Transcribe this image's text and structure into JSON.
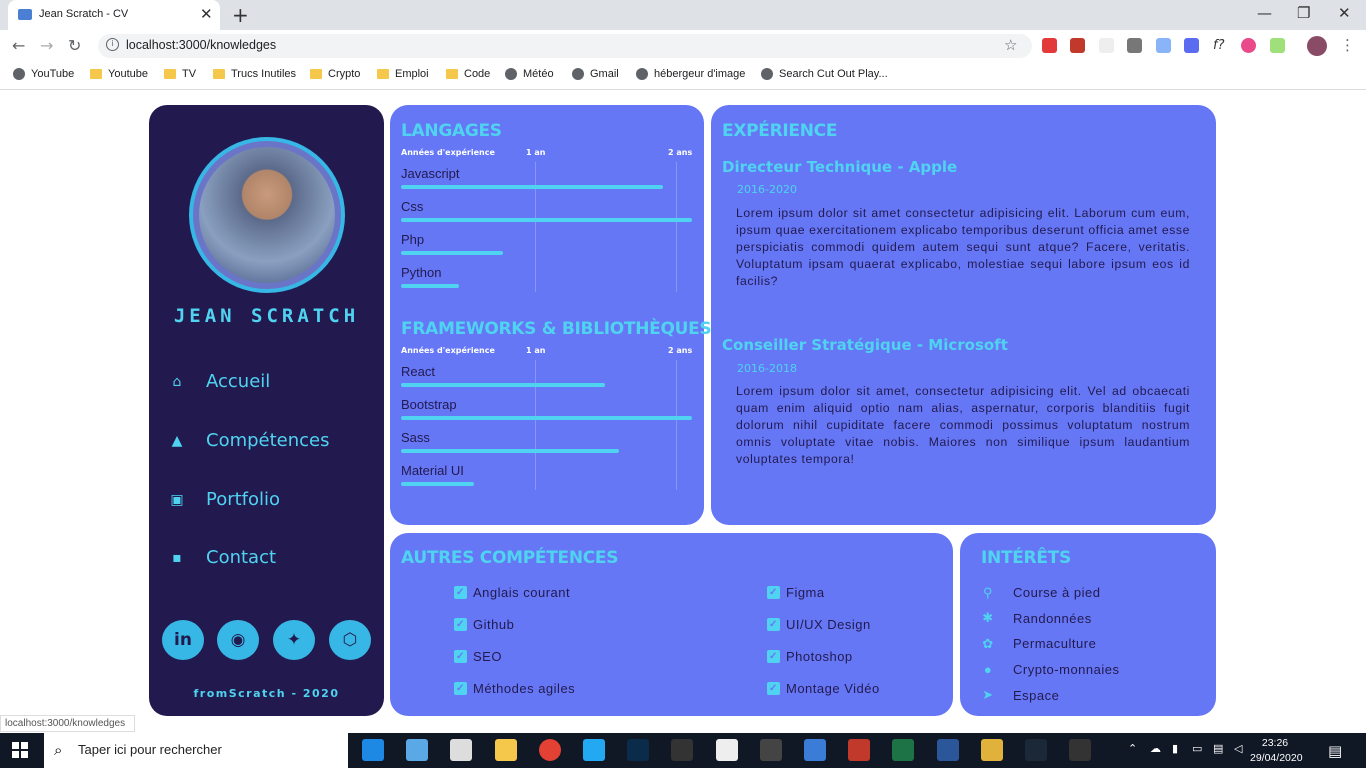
{
  "browser": {
    "tab_title": "Jean Scratch - CV",
    "url": "localhost:3000/knowledges",
    "status_url": "localhost:3000/knowledges",
    "bookmarks": [
      {
        "label": "YouTube",
        "icon": "globe-icon"
      },
      {
        "label": "Youtube",
        "icon": "folder-icon"
      },
      {
        "label": "TV",
        "icon": "folder-icon"
      },
      {
        "label": "Trucs Inutiles",
        "icon": "folder-icon"
      },
      {
        "label": "Crypto",
        "icon": "folder-icon"
      },
      {
        "label": "Emploi",
        "icon": "folder-icon"
      },
      {
        "label": "Code",
        "icon": "folder-icon"
      },
      {
        "label": "Météo",
        "icon": "globe-icon"
      },
      {
        "label": "Gmail",
        "icon": "globe-icon"
      },
      {
        "label": "hébergeur d'image",
        "icon": "globe-icon"
      },
      {
        "label": "Search Cut Out Play...",
        "icon": "globe-icon"
      }
    ]
  },
  "sidebar": {
    "name": "JEAN SCRATCH",
    "nav": [
      {
        "label": "Accueil",
        "icon": "home-icon"
      },
      {
        "label": "Compétences",
        "icon": "triangle-icon"
      },
      {
        "label": "Portfolio",
        "icon": "images-icon"
      },
      {
        "label": "Contact",
        "icon": "contact-icon"
      }
    ],
    "social": [
      "linkedin-icon",
      "github-icon",
      "twitter-icon",
      "codepen-icon"
    ],
    "footer": "fromScratch - 2020"
  },
  "langages": {
    "title": "LANGAGES",
    "scale": [
      "Années d'expérience",
      "1 an",
      "2 ans"
    ],
    "items": [
      {
        "label": "Javascript",
        "value": 0.9
      },
      {
        "label": "Css",
        "value": 1.0
      },
      {
        "label": "Php",
        "value": 0.35
      },
      {
        "label": "Python",
        "value": 0.2
      }
    ]
  },
  "frameworks": {
    "title": "FRAMEWORKS & BIBLIOTHÈQUES",
    "scale": [
      "Années d'expérience",
      "1 an",
      "2 ans"
    ],
    "items": [
      {
        "label": "React",
        "value": 0.7
      },
      {
        "label": "Bootstrap",
        "value": 1.0
      },
      {
        "label": "Sass",
        "value": 0.75
      },
      {
        "label": "Material UI",
        "value": 0.25
      }
    ]
  },
  "experience": {
    "title": "EXPÉRIENCE",
    "jobs": [
      {
        "title": "Directeur Technique - Apple",
        "dates": "2016-2020",
        "text": "Lorem ipsum dolor sit amet consectetur adipisicing elit. Laborum cum eum, ipsum quae exercitationem explicabo temporibus deserunt officia amet esse perspiciatis commodi quidem autem sequi sunt atque? Facere, veritatis. Voluptatum ipsam quaerat explicabo, molestiae sequi labore ipsum eos id facilis?"
      },
      {
        "title": "Conseiller Stratégique - Microsoft",
        "dates": "2016-2018",
        "text": "Lorem ipsum dolor sit amet, consectetur adipisicing elit. Vel ad obcaecati quam enim aliquid optio nam alias, aspernatur, corporis blanditiis fugit dolorum nihil cupiditate facere commodi possimus voluptatum nostrum omnis voluptate vitae nobis. Maiores non similique ipsum laudantium voluptates tempora!"
      }
    ]
  },
  "autres": {
    "title": "AUTRES COMPÉTENCES",
    "left": [
      "Anglais courant",
      "Github",
      "SEO",
      "Méthodes agiles"
    ],
    "right": [
      "Figma",
      "UI/UX Design",
      "Photoshop",
      "Montage Vidéo"
    ]
  },
  "interets": {
    "title": "INTÉRÊTS",
    "items": [
      {
        "label": "Course à pied",
        "icon": "running-icon"
      },
      {
        "label": "Randonnées",
        "icon": "hiking-icon"
      },
      {
        "label": "Permaculture",
        "icon": "seedling-icon"
      },
      {
        "label": "Crypto-monnaies",
        "icon": "coin-icon"
      },
      {
        "label": "Espace",
        "icon": "rocket-icon"
      }
    ]
  },
  "taskbar": {
    "search_placeholder": "Taper ici pour rechercher",
    "time": "23:26",
    "date": "29/04/2020"
  },
  "colors": {
    "sidebar": "#221a4f",
    "card": "#6677f5",
    "accent": "#4fd3f0"
  }
}
